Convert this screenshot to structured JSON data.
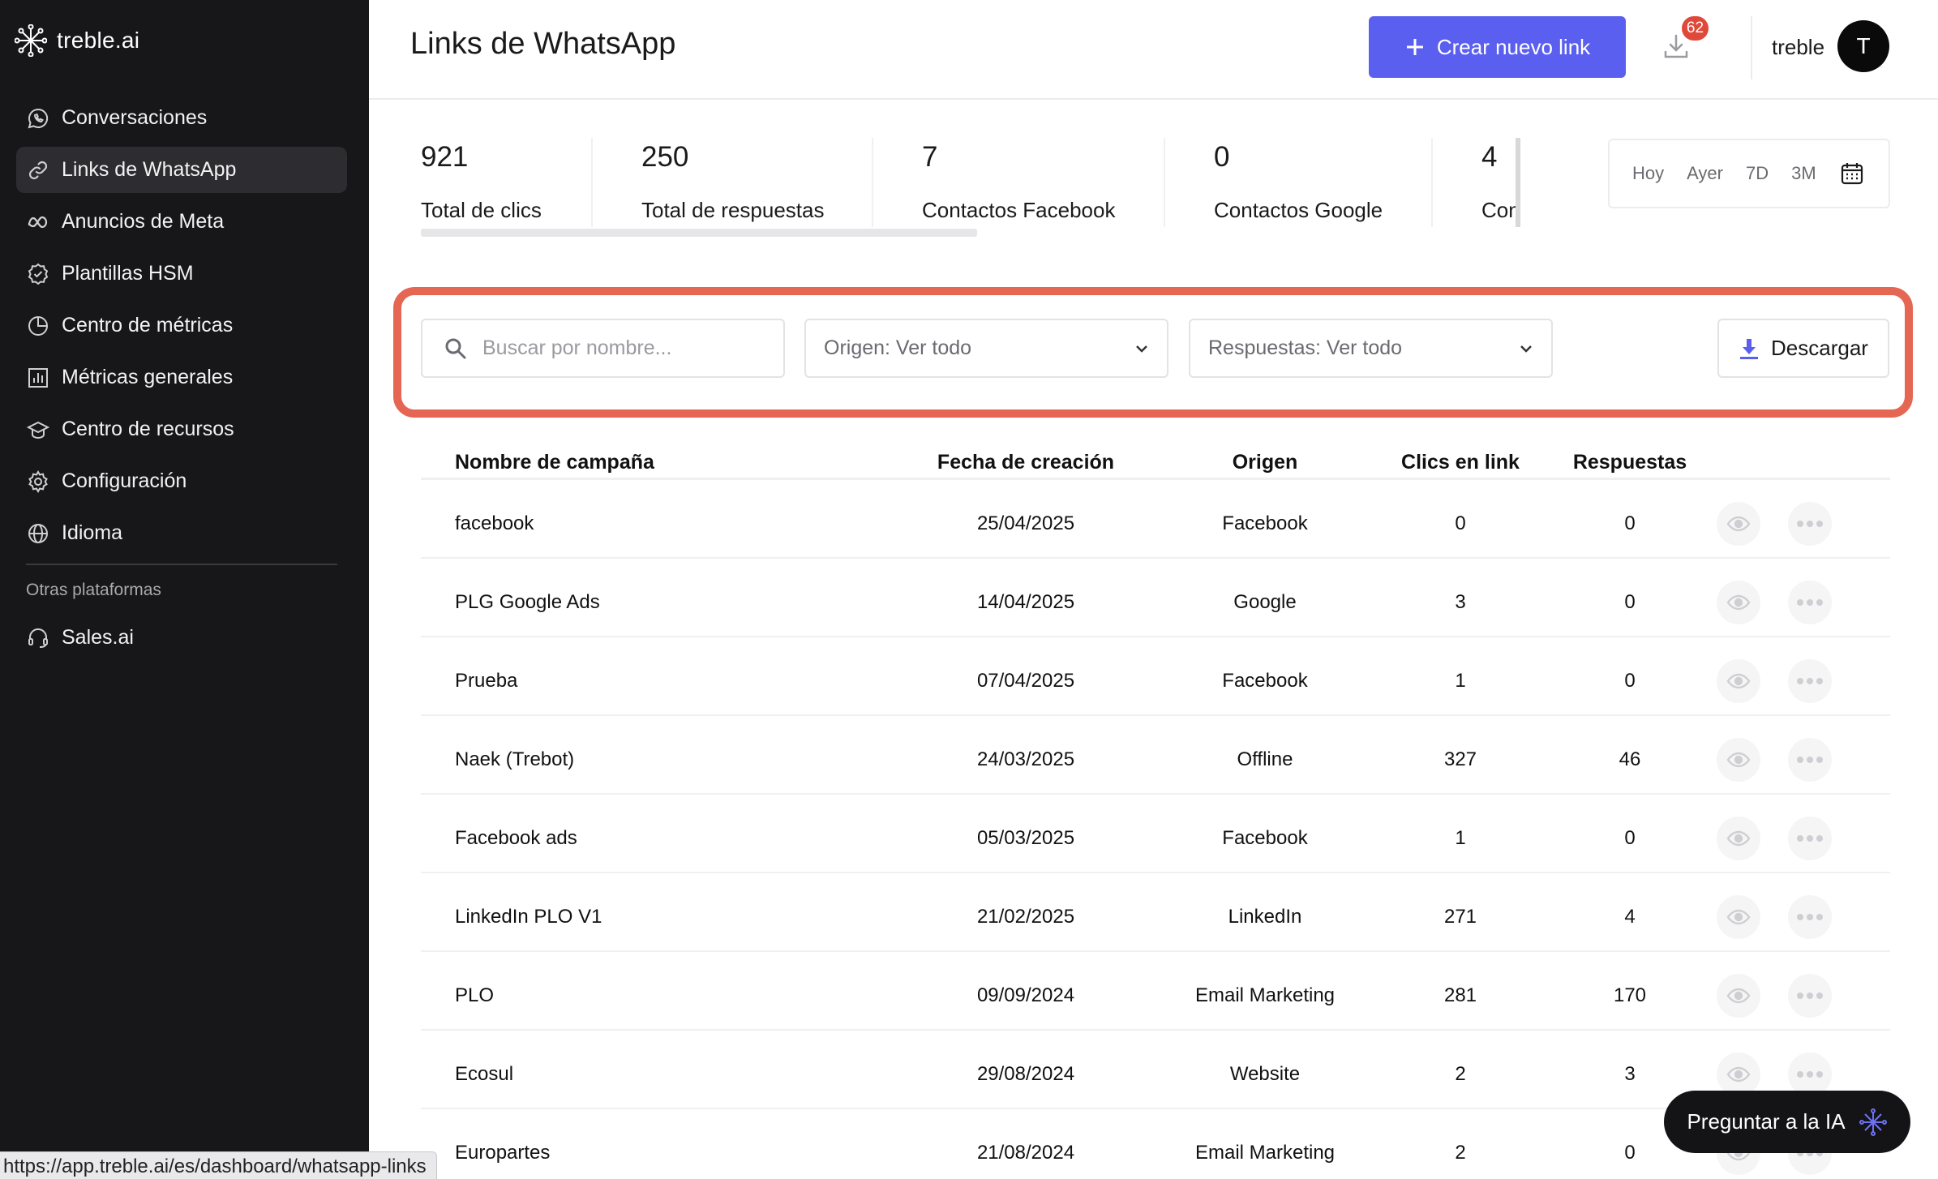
{
  "app": {
    "logo_text": "treble.ai"
  },
  "sidebar": {
    "items": [
      {
        "label": "Conversaciones",
        "icon": "whatsapp-icon"
      },
      {
        "label": "Links de WhatsApp",
        "icon": "link-icon",
        "active": true
      },
      {
        "label": "Anuncios de Meta",
        "icon": "meta-icon"
      },
      {
        "label": "Plantillas HSM",
        "icon": "badge-check-icon"
      },
      {
        "label": "Centro de métricas",
        "icon": "pie-chart-icon"
      },
      {
        "label": "Métricas generales",
        "icon": "bar-chart-icon"
      },
      {
        "label": "Centro de recursos",
        "icon": "graduation-cap-icon"
      },
      {
        "label": "Configuración",
        "icon": "gear-icon"
      },
      {
        "label": "Idioma",
        "icon": "globe-icon"
      }
    ],
    "other_platforms_title": "Otras plataformas",
    "other_items": [
      {
        "label": "Sales.ai",
        "icon": "headset-icon"
      }
    ]
  },
  "header": {
    "title": "Links de WhatsApp",
    "create_button": "Crear nuevo link",
    "downloads_badge": "62",
    "user_name": "treble",
    "avatar_initial": "T"
  },
  "stats": [
    {
      "value": "921",
      "label": "Total de clics"
    },
    {
      "value": "250",
      "label": "Total de respuestas"
    },
    {
      "value": "7",
      "label": "Contactos Facebook"
    },
    {
      "value": "0",
      "label": "Contactos Google"
    },
    {
      "value": "4",
      "label": "Con"
    }
  ],
  "date_filter": {
    "options": [
      "Hoy",
      "Ayer",
      "7D",
      "3M"
    ]
  },
  "filters": {
    "search_placeholder": "Buscar por nombre...",
    "origin_select": "Origen: Ver todo",
    "responses_select": "Respuestas: Ver todo",
    "download_button": "Descargar"
  },
  "table": {
    "headers": {
      "name": "Nombre de campaña",
      "date": "Fecha de creación",
      "origin": "Origen",
      "clicks": "Clics en link",
      "responses": "Respuestas"
    },
    "rows": [
      {
        "name": "facebook",
        "date": "25/04/2025",
        "origin": "Facebook",
        "clicks": "0",
        "responses": "0"
      },
      {
        "name": "PLG Google Ads",
        "date": "14/04/2025",
        "origin": "Google",
        "clicks": "3",
        "responses": "0"
      },
      {
        "name": "Prueba",
        "date": "07/04/2025",
        "origin": "Facebook",
        "clicks": "1",
        "responses": "0"
      },
      {
        "name": "Naek (Trebot)",
        "date": "24/03/2025",
        "origin": "Offline",
        "clicks": "327",
        "responses": "46"
      },
      {
        "name": "Facebook ads",
        "date": "05/03/2025",
        "origin": "Facebook",
        "clicks": "1",
        "responses": "0"
      },
      {
        "name": "LinkedIn PLO V1",
        "date": "21/02/2025",
        "origin": "LinkedIn",
        "clicks": "271",
        "responses": "4"
      },
      {
        "name": "PLO",
        "date": "09/09/2024",
        "origin": "Email Marketing",
        "clicks": "281",
        "responses": "170"
      },
      {
        "name": "Ecosul",
        "date": "29/08/2024",
        "origin": "Website",
        "clicks": "2",
        "responses": "3"
      },
      {
        "name": "Europartes",
        "date": "21/08/2024",
        "origin": "Email Marketing",
        "clicks": "2",
        "responses": "0"
      }
    ]
  },
  "ai_button": {
    "label": "Preguntar a la IA"
  },
  "status_bar": {
    "url": "https://app.treble.ai/es/dashboard/whatsapp-links"
  },
  "colors": {
    "sidebar_bg": "#17171a",
    "primary": "#5a5ff0",
    "highlight": "#e56652",
    "badge": "#e0483a"
  }
}
